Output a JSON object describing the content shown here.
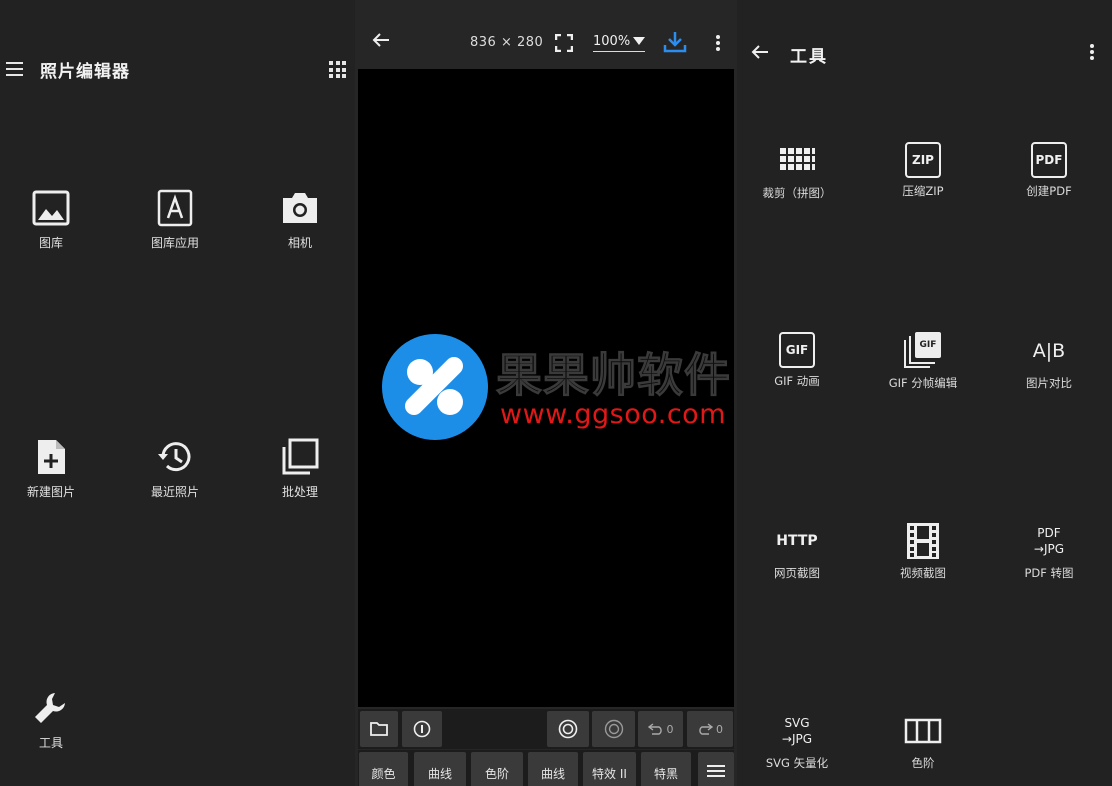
{
  "left": {
    "title": "照片编辑器",
    "tiles": [
      {
        "label": "图库",
        "icon": "image-icon"
      },
      {
        "label": "图库应用",
        "icon": "font-a-icon"
      },
      {
        "label": "相机",
        "icon": "camera-icon"
      },
      {
        "label": "新建图片",
        "icon": "new-file-icon"
      },
      {
        "label": "最近照片",
        "icon": "history-icon"
      },
      {
        "label": "批处理",
        "icon": "batch-icon"
      },
      {
        "label": "工具",
        "icon": "wrench-icon"
      }
    ]
  },
  "editor": {
    "dims": "836 × 280",
    "zoom": "100%",
    "watermark": {
      "title": "果果帅软件",
      "url": "www.ggsoo.com"
    },
    "undo_count": "0",
    "redo_count": "0",
    "bottom_tabs": [
      "颜色",
      "曲线",
      "色阶",
      "曲线",
      "特效 II",
      "特黑"
    ]
  },
  "tools": {
    "title": "工具",
    "items": [
      {
        "label": "裁剪（拼图）",
        "icon": "grid-crop-icon"
      },
      {
        "label": "压缩ZIP",
        "icon_text": "ZIP"
      },
      {
        "label": "创建PDF",
        "icon_text": "PDF"
      },
      {
        "label": "GIF 动画",
        "icon_text": "GIF"
      },
      {
        "label": "GIF 分帧编辑",
        "icon_text": "GIF"
      },
      {
        "label": "图片对比",
        "icon_text": "A|B"
      },
      {
        "label": "网页截图",
        "icon_text": "HTTP"
      },
      {
        "label": "视频截图",
        "icon": "film-icon"
      },
      {
        "label": "PDF 转图",
        "icon_line1": "PDF",
        "icon_line2": "→JPG"
      },
      {
        "label": "SVG 矢量化",
        "icon_line1": "SVG",
        "icon_line2": "→JPG"
      },
      {
        "label": "色阶",
        "icon": "columns-icon"
      }
    ]
  }
}
